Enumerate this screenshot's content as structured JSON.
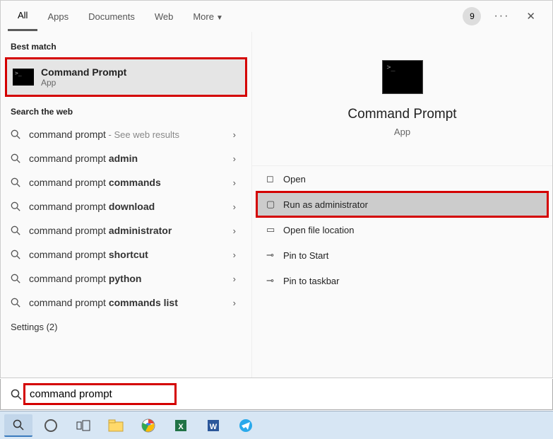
{
  "tabs": {
    "all": "All",
    "apps": "Apps",
    "documents": "Documents",
    "web": "Web",
    "more": "More"
  },
  "badge": "9",
  "sections": {
    "best": "Best match",
    "web": "Search the web",
    "settings": "Settings (2)"
  },
  "best": {
    "title": "Command Prompt",
    "sub": "App"
  },
  "web_results": [
    {
      "prefix": "command prompt",
      "bold": "",
      "hint": " - See web results"
    },
    {
      "prefix": "command prompt ",
      "bold": "admin",
      "hint": ""
    },
    {
      "prefix": "command prompt ",
      "bold": "commands",
      "hint": ""
    },
    {
      "prefix": "command prompt ",
      "bold": "download",
      "hint": ""
    },
    {
      "prefix": "command prompt ",
      "bold": "administrator",
      "hint": ""
    },
    {
      "prefix": "command prompt ",
      "bold": "shortcut",
      "hint": ""
    },
    {
      "prefix": "command prompt ",
      "bold": "python",
      "hint": ""
    },
    {
      "prefix": "command prompt ",
      "bold": "commands list",
      "hint": ""
    }
  ],
  "preview": {
    "title": "Command Prompt",
    "sub": "App"
  },
  "actions": {
    "open": "Open",
    "runadmin": "Run as administrator",
    "openloc": "Open file location",
    "pinstart": "Pin to Start",
    "pintask": "Pin to taskbar"
  },
  "search": {
    "value": "command prompt"
  }
}
